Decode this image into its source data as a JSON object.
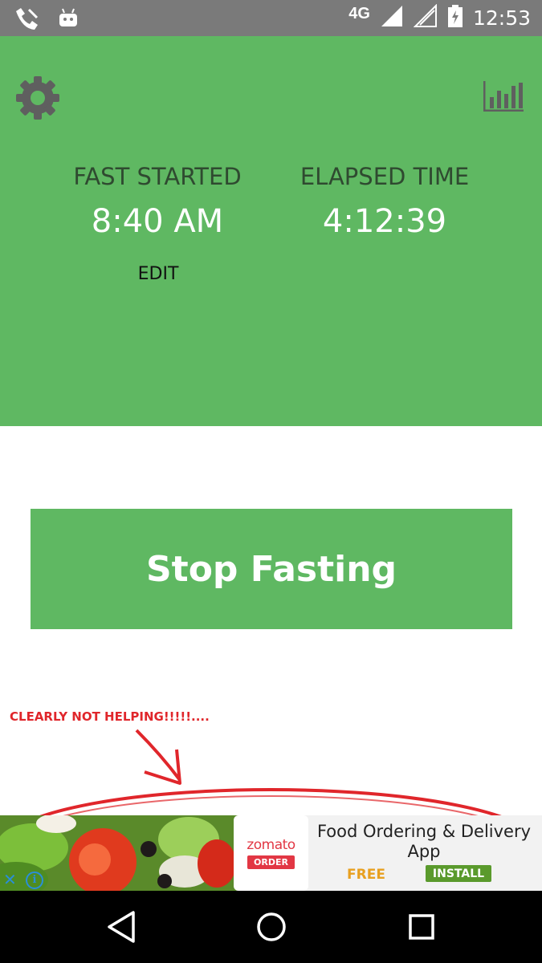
{
  "status_bar": {
    "network": "4G",
    "time": "12:53",
    "icons": [
      "call-app-icon",
      "android-icon",
      "signal-icon",
      "signal-empty-icon",
      "battery-charging-icon"
    ]
  },
  "header": {
    "settings_icon": "gear-icon",
    "stats_icon": "bar-chart-icon",
    "fast_started_label": "FAST STARTED",
    "fast_started_value": "8:40 AM",
    "edit_label": "EDIT",
    "elapsed_label": "ELAPSED TIME",
    "elapsed_value": "4:12:39"
  },
  "main": {
    "stop_button_label": "Stop Fasting"
  },
  "annotation": {
    "text": "CLEARLY NOT HELPING!!!!!...."
  },
  "ad": {
    "brand": "zomato",
    "brand_tag": "ORDER",
    "title": "Food Ordering & Delivery App",
    "price": "FREE",
    "install_label": "INSTALL",
    "close_icon": "close-icon",
    "info_icon": "info-icon"
  },
  "nav": {
    "back_icon": "back-triangle-icon",
    "home_icon": "home-circle-icon",
    "recents_icon": "recents-square-icon"
  },
  "colors": {
    "accent_green": "#5fb862",
    "label_dark_green": "#2f4a30",
    "status_bar": "#7a7a7a",
    "annotation_red": "#e0262b",
    "zomato_red": "#e23744",
    "install_green": "#5a9a2c",
    "free_orange": "#e8a020"
  }
}
